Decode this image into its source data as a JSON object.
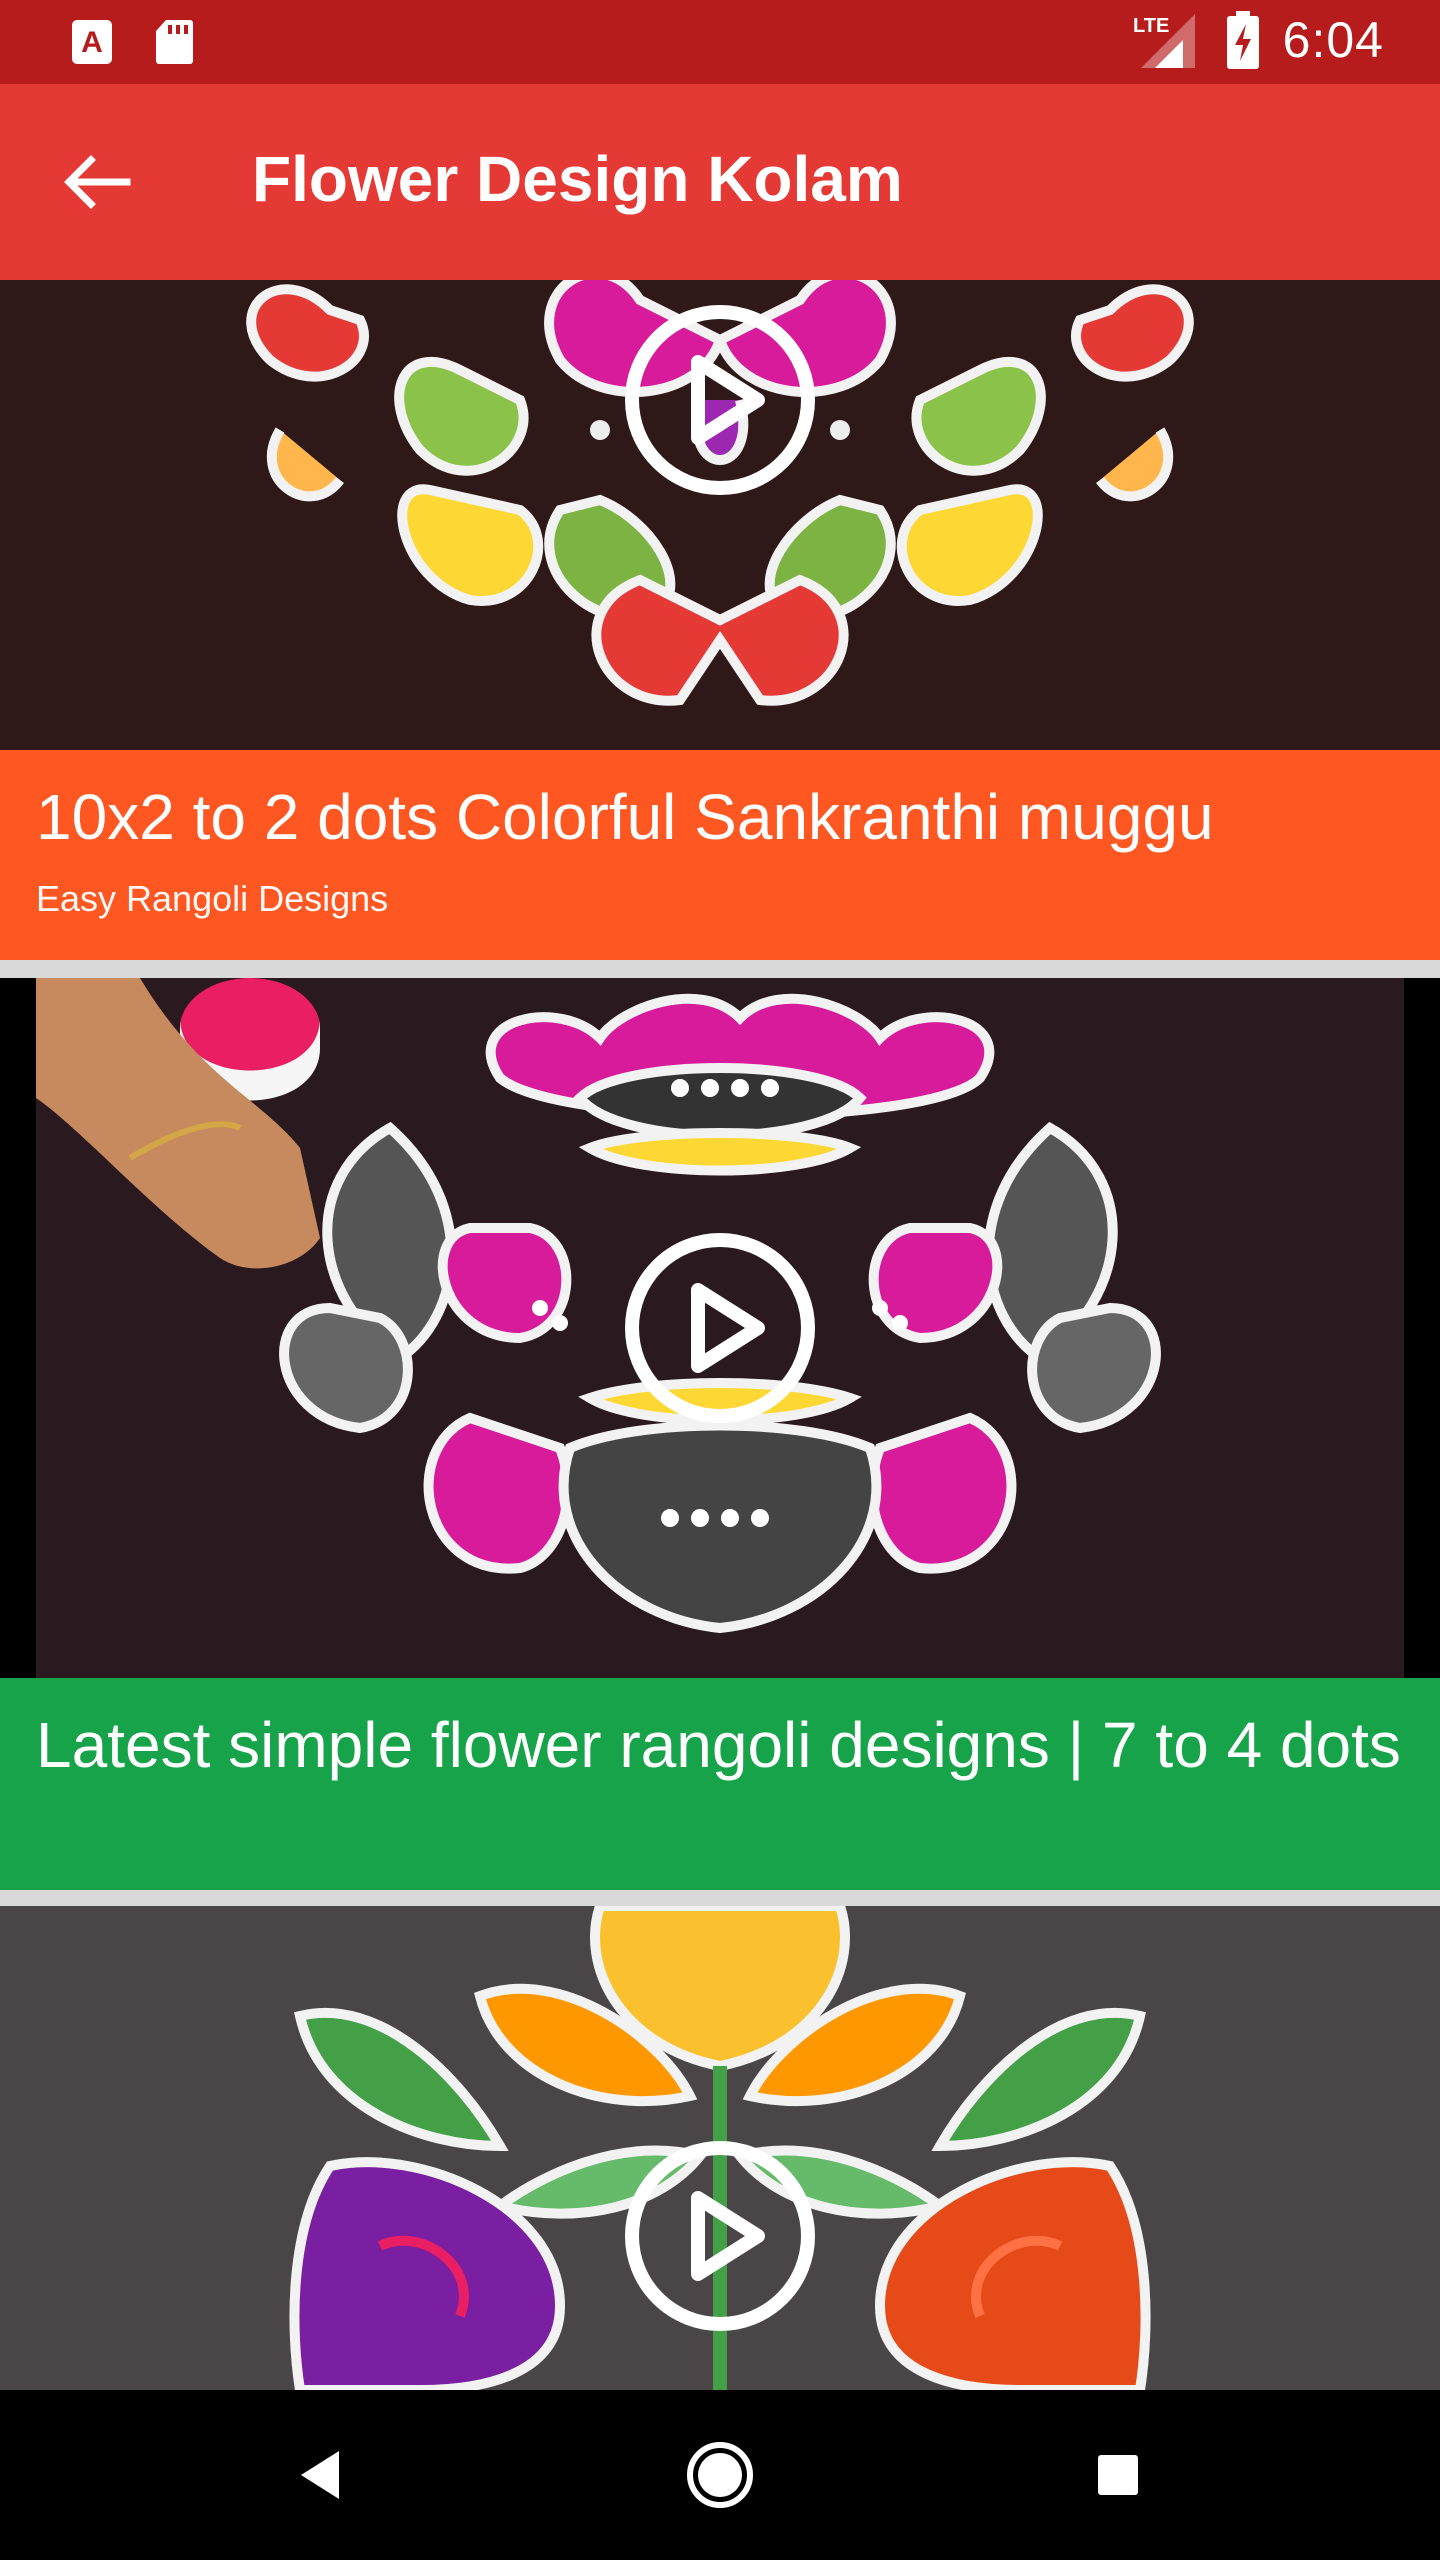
{
  "status_bar": {
    "time": "6:04",
    "network": "LTE",
    "icons": [
      "text-a-icon",
      "sd-card-icon",
      "lte-signal-icon",
      "battery-charging-icon"
    ]
  },
  "app_bar": {
    "title": "Flower Design Kolam",
    "back_icon": "arrow-back-icon",
    "color": "#e53935",
    "status_color": "#b71c1c"
  },
  "videos": [
    {
      "title": "",
      "channel": "",
      "caption_color": "#ff5722"
    },
    {
      "title": "10x2 to 2 dots Colorful Sankranthi muggu",
      "channel": "Easy Rangoli Designs",
      "caption_color": "#ff5722"
    },
    {
      "title": "Latest simple flower rangoli designs | 7 to 4 dots",
      "channel": "",
      "caption_color": "#16a34a"
    },
    {
      "title": "",
      "channel": "",
      "caption_color": "#e53935"
    }
  ],
  "nav_bar": {
    "back": "nav-back-icon",
    "home": "nav-home-icon",
    "recents": "nav-recents-icon"
  }
}
